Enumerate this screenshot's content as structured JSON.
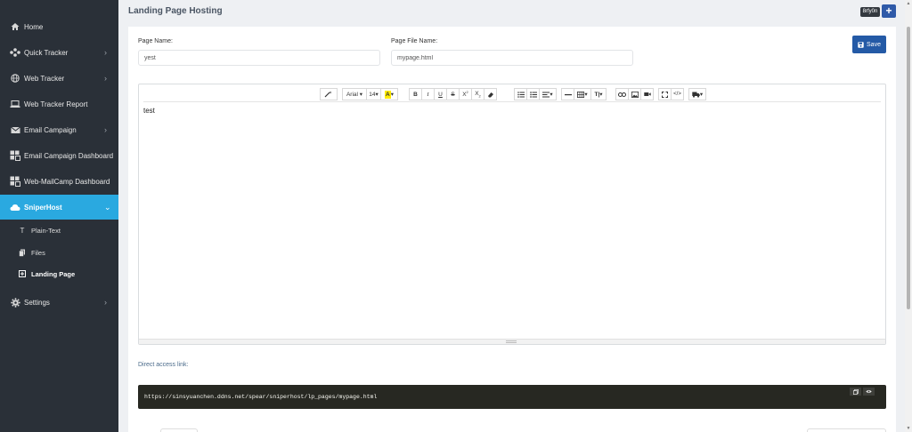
{
  "sidebar": {
    "items": [
      {
        "label": "Home",
        "icon": "home-icon"
      },
      {
        "label": "Quick Tracker",
        "icon": "tracker-icon"
      },
      {
        "label": "Web Tracker",
        "icon": "globe-icon"
      },
      {
        "label": "Web Tracker Report",
        "icon": "laptop-icon"
      },
      {
        "label": "Email Campaign",
        "icon": "envelope-icon"
      },
      {
        "label": "Email Campaign Dashboard",
        "icon": "dashboard-icon"
      },
      {
        "label": "Web-MailCamp Dashboard",
        "icon": "dashboard-icon"
      },
      {
        "label": "SniperHost",
        "icon": "cloud-icon"
      },
      {
        "label": "Settings",
        "icon": "gear-icon"
      }
    ],
    "subitems": [
      {
        "label": "Plain-Text",
        "icon": "text-icon"
      },
      {
        "label": "Files",
        "icon": "files-icon"
      },
      {
        "label": "Landing Page",
        "icon": "page-icon"
      }
    ]
  },
  "header": {
    "title": "Landing Page Hosting",
    "id_badge": "8rfy0n",
    "add_label": "+"
  },
  "form": {
    "page_name_label": "Page Name:",
    "page_name_value": "yest",
    "file_name_label": "Page File Name:",
    "file_name_value": "mypage.html",
    "save_label": "Save"
  },
  "editor": {
    "font_name": "Arial",
    "font_size": "14",
    "content": "test"
  },
  "access": {
    "label": "Direct access link:",
    "url": "https://sinsyuanchen.ddns.net/spear/sniperhost/lp_pages/mypage.html"
  },
  "colors": {
    "sidebar_bg": "#2a3038",
    "active_item": "#2aa9e0",
    "save_button": "#245aa6",
    "code_bg": "#272822"
  }
}
